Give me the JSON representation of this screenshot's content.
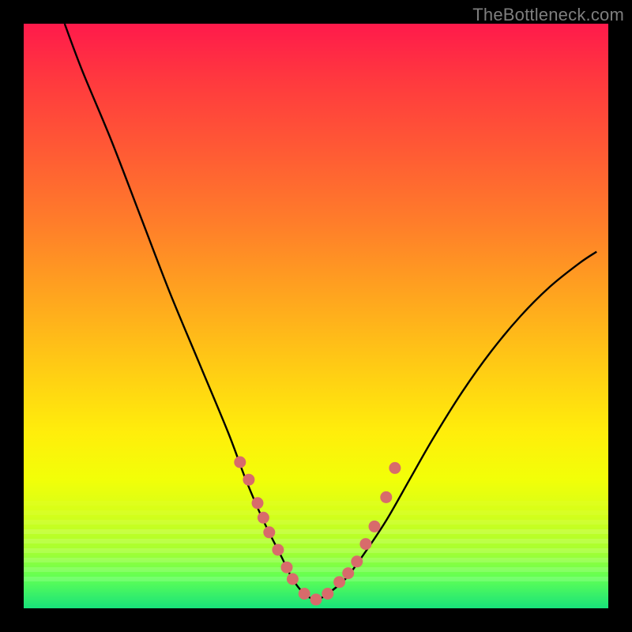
{
  "watermark": "TheBottleneck.com",
  "chart_data": {
    "type": "line",
    "title": "",
    "xlabel": "",
    "ylabel": "",
    "xlim": [
      0,
      100
    ],
    "ylim": [
      0,
      100
    ],
    "grid": false,
    "legend": false,
    "series": [
      {
        "name": "curve",
        "x": [
          7,
          10,
          15,
          20,
          25,
          30,
          35,
          38,
          41,
          44,
          46,
          48,
          50,
          52,
          55,
          58,
          62,
          66,
          70,
          75,
          80,
          85,
          90,
          95,
          98
        ],
        "y": [
          100,
          92,
          80,
          67,
          54,
          42,
          30,
          22,
          15,
          9,
          5,
          2.5,
          1.5,
          2.5,
          5,
          9,
          15,
          22,
          29,
          37,
          44,
          50,
          55,
          59,
          61
        ]
      }
    ],
    "scatter_points": {
      "name": "dots",
      "x": [
        37,
        38.5,
        40,
        41,
        42,
        43.5,
        45,
        46,
        48,
        50,
        52,
        54,
        55.5,
        57,
        58.5,
        60,
        62,
        63.5
      ],
      "y": [
        25,
        22,
        18,
        15.5,
        13,
        10,
        7,
        5,
        2.5,
        1.5,
        2.5,
        4.5,
        6,
        8,
        11,
        14,
        19,
        24
      ]
    },
    "background_scale": {
      "top_color": "#ff1a4b",
      "bottom_color": "#18e27a",
      "meaning": "red=high bottleneck, green=low bottleneck"
    }
  }
}
